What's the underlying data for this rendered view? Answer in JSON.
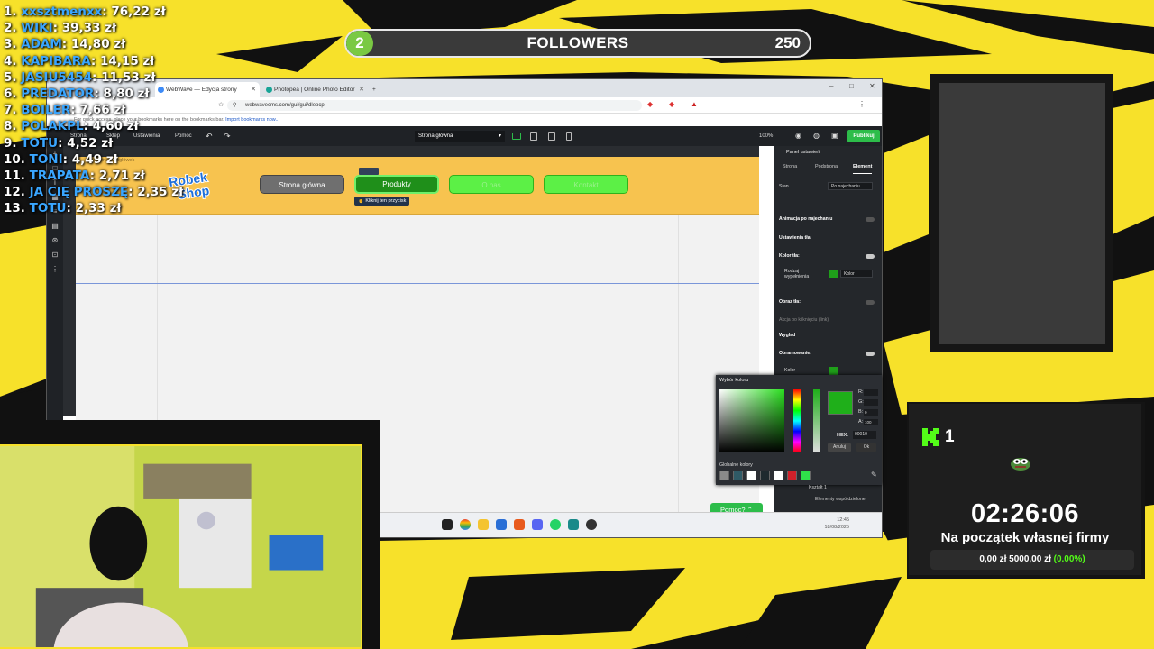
{
  "overlay": {
    "colors": {
      "yellow": "#f7e12a",
      "black": "#111111",
      "kick_green": "#53fc18",
      "name_blue": "#3aa6ff"
    }
  },
  "followers": {
    "current": "2",
    "label": "FOLLOWERS",
    "goal": "250",
    "progress_fraction": 0.008
  },
  "leaderboard": [
    {
      "rank": "1.",
      "name": "xxsztmenxx",
      "amount": "76,22 zł"
    },
    {
      "rank": "2.",
      "name": "WIKI",
      "amount": "39,33 zł"
    },
    {
      "rank": "3.",
      "name": "ADAM",
      "amount": "14,80 zł"
    },
    {
      "rank": "4.",
      "name": "KAPIBARA",
      "amount": "14,15 zł"
    },
    {
      "rank": "5.",
      "name": "JASIU5454",
      "amount": "11,53 zł"
    },
    {
      "rank": "6.",
      "name": "PREDATOR",
      "amount": "8,80 zł"
    },
    {
      "rank": "7.",
      "name": "BOILER",
      "amount": "7,66 zł"
    },
    {
      "rank": "8.",
      "name": "POLAKPL",
      "amount": "4,60 zł"
    },
    {
      "rank": "9.",
      "name": "TOTU",
      "amount": "4,52 zł"
    },
    {
      "rank": "10.",
      "name": "TONI",
      "amount": "4,49 zł"
    },
    {
      "rank": "11.",
      "name": "TRAPATA",
      "amount": "2,71 zł"
    },
    {
      "rank": "12.",
      "name": "JA CIĘ PROSZĘ",
      "amount": "2,35 zł"
    },
    {
      "rank": "13.",
      "name": "TOTU",
      "amount": "2,33 zł"
    }
  ],
  "browser": {
    "tabs": [
      {
        "title": "WebWave — Edycja strony",
        "active": true
      },
      {
        "title": "Photopea | Online Photo Editor",
        "active": false
      }
    ],
    "new_tab": "+",
    "url": "webwavecms.com/gui/gui/dlepcp",
    "bookmark_bar_text": "For quick access, place your bookmarks here on the bookmarks bar.",
    "bookmark_link": "Import bookmarks now...",
    "window_controls": [
      "–",
      "□",
      "✕"
    ]
  },
  "editor": {
    "menu": [
      "Strona",
      "Sklep",
      "Ustawienia",
      "Pomoc"
    ],
    "undo": "↶",
    "redo": "↷",
    "page_select": "Strona główna",
    "zoom": "100%",
    "publish_label": "Publikuj",
    "canvas": {
      "breadcrumb": "Strona · Nagłówek",
      "logo_text": [
        "Robek",
        "Shop"
      ],
      "nav_buttons": [
        {
          "label": "Strona główna",
          "style": "gray"
        },
        {
          "label": "Produkty",
          "style": "selected"
        },
        {
          "label": "O nas",
          "style": "lime"
        },
        {
          "label": "Kontakt",
          "style": "lime"
        }
      ],
      "selection_hint": "Kliknij ten przycisk"
    },
    "right_panel": {
      "title": "Panel ustawień",
      "tabs": [
        "Strona",
        "Podstrona",
        "Element"
      ],
      "active_tab": "Element",
      "state_label": "Stan",
      "state_value": "Po najechaniu",
      "hover_animation": "Animacja po najechaniu",
      "bg_section": "Ustawienia tła",
      "bg_color": "Kolor tła:",
      "fill_type": "Rodzaj wypełnienia",
      "fill_value": "Kolor",
      "bg_image": "Obraz tła:",
      "click_action": "Akcja po kliknięciu (link)",
      "look_section": "Wygląd",
      "border": "Obramowanie:",
      "border_color": "Kolor",
      "current_color": "#1f9f1a"
    },
    "color_picker": {
      "title": "Wybór koloru",
      "channels": [
        {
          "label": "R:",
          "value": ""
        },
        {
          "label": "G:",
          "value": ""
        },
        {
          "label": "B:",
          "value": "0"
        },
        {
          "label": "A:",
          "value": "100"
        }
      ],
      "hex_label": "HEX:",
      "hex_value": "00010",
      "cancel": "Anuluj",
      "ok": "Ok",
      "global_label": "Globalne kolory",
      "global_colors": [
        "#8a8a8a",
        "#2f5a66",
        "#ffffff",
        "#1f2a2e",
        "#ffffff",
        "#d0202a",
        "#2fdf4a"
      ]
    },
    "help_button": "Pomoc?",
    "layers": [
      "Kształt 1",
      "Elementy współdzielone"
    ]
  },
  "taskbar": {
    "time": "12:45",
    "date": "18/08/2025"
  },
  "goal": {
    "kick_count": "1",
    "timer": "02:26:06",
    "title": "Na początek własnej firmy",
    "current": "0,00 zł",
    "target": "5000,00 zł",
    "percent": "(0.00%)",
    "progress_fraction": 0.0
  }
}
